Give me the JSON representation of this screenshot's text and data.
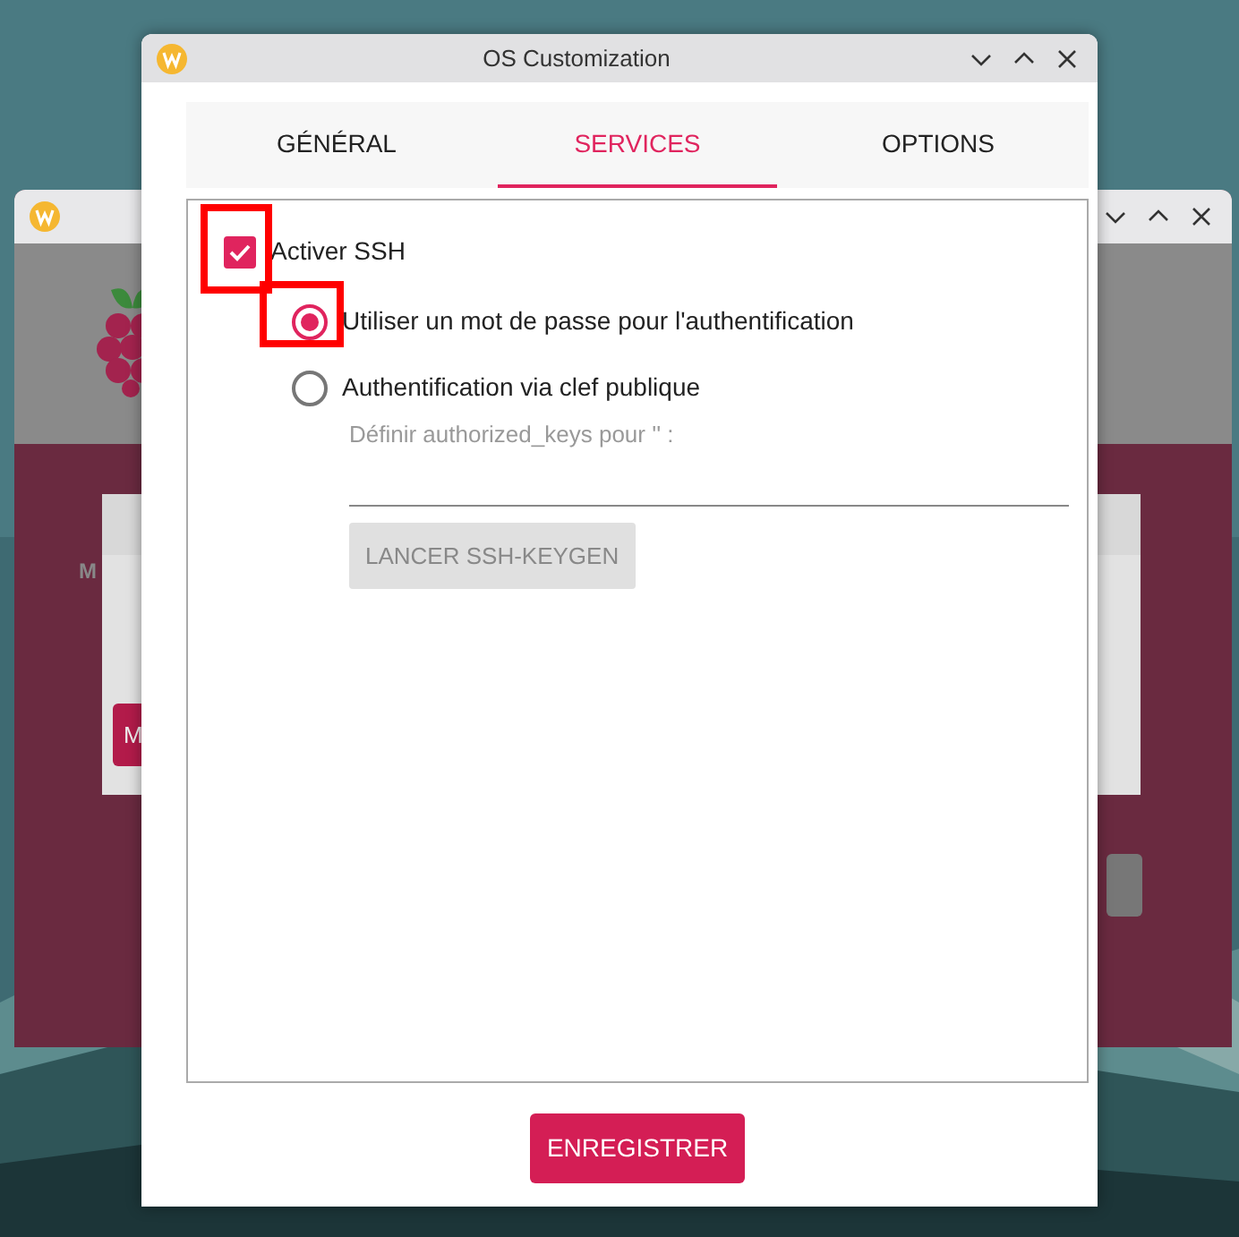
{
  "window": {
    "title": "OS Customization"
  },
  "tabs": [
    {
      "label": "GÉNÉRAL",
      "selected": false
    },
    {
      "label": "SERVICES",
      "selected": true
    },
    {
      "label": "OPTIONS",
      "selected": false
    }
  ],
  "ssh": {
    "label": "Activer SSH",
    "checked": true,
    "highlighted": true
  },
  "auth_options": [
    {
      "label": "Utiliser un mot de passe pour l'authentification",
      "selected": true,
      "highlighted": true
    },
    {
      "label": "Authentification via clef publique",
      "selected": false,
      "highlighted": false
    }
  ],
  "authorized_keys": {
    "label": "Définir authorized_keys pour '' :",
    "disabled": true
  },
  "keygen_button": {
    "label": "LANCER SSH-KEYGEN",
    "disabled": true
  },
  "save_button": {
    "label": "ENREGISTRER"
  },
  "background_window": {
    "label": "M",
    "button": "M"
  }
}
